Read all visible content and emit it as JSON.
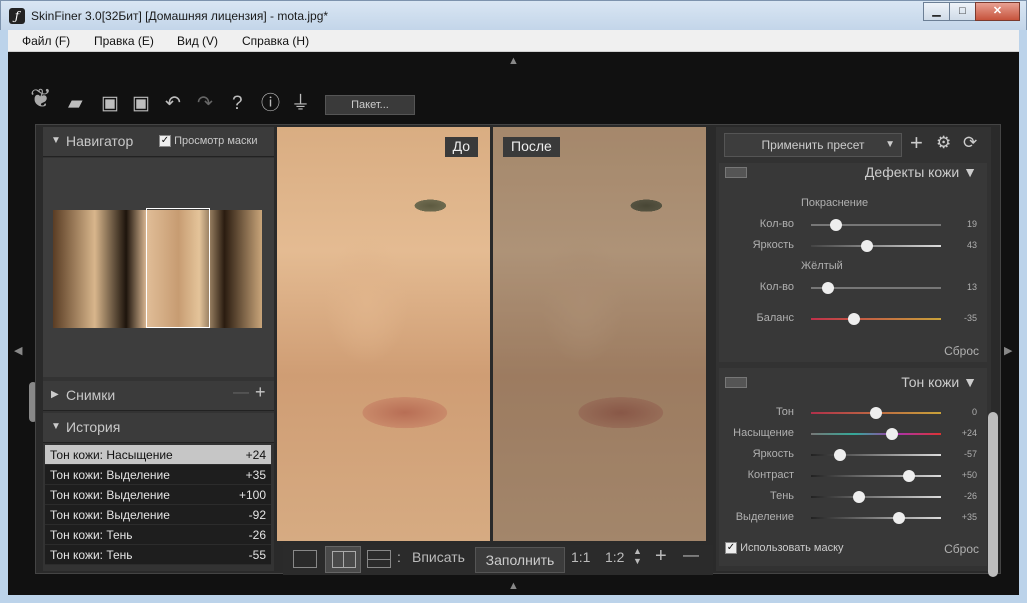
{
  "window": {
    "title": "SkinFiner 3.0[32Бит] [Домашняя лицензия] - mota.jpg*",
    "min": "▁",
    "max": "□",
    "close": "✕"
  },
  "menu": [
    {
      "label": "Файл (F)"
    },
    {
      "label": "Правка (E)"
    },
    {
      "label": "Вид (V)"
    },
    {
      "label": "Справка (H)"
    }
  ],
  "toolbar": {
    "batch_label": "Пакет..."
  },
  "navigator": {
    "title": "Навигатор",
    "mask_preview_label": "Просмотр маски"
  },
  "snapshots": {
    "title": "Снимки",
    "minus": "—",
    "plus": "+"
  },
  "history": {
    "title": "История",
    "items": [
      {
        "name": "Тон кожи: Насыщение",
        "value": "+24"
      },
      {
        "name": "Тон кожи: Выделение",
        "value": "+35"
      },
      {
        "name": "Тон кожи: Выделение",
        "value": "+100"
      },
      {
        "name": "Тон кожи: Выделение",
        "value": "-92"
      },
      {
        "name": "Тон кожи: Тень",
        "value": "-26"
      },
      {
        "name": "Тон кожи: Тень",
        "value": "-55"
      }
    ]
  },
  "preview": {
    "before_label": "До",
    "after_label": "После"
  },
  "view_bar": {
    "separator": ":",
    "fit_label": "Вписать",
    "fill_label": "Заполнить",
    "zoom_1_1": "1:1",
    "zoom_1_2": "1:2",
    "zoom_in": "+",
    "zoom_out": "—"
  },
  "preset": {
    "label": "Применить пресет",
    "arrow": "▼"
  },
  "skin_defects": {
    "title": "Дефекты кожи",
    "group_redness": "Покраснение",
    "group_yellow": "Жёлтый",
    "amount1": {
      "label": "Кол-во",
      "value": "19",
      "level": 0.19
    },
    "brightness": {
      "label": "Яркость",
      "value": "43",
      "level": 0.43
    },
    "amount2": {
      "label": "Кол-во",
      "value": "13",
      "level": 0.13
    },
    "balance": {
      "label": "Баланс",
      "value": "-35",
      "level": 0.33
    },
    "reset": "Сброс"
  },
  "skin_tone": {
    "title": "Тон кожи",
    "sliders": [
      {
        "label": "Тон",
        "value": "0",
        "level": 0.5
      },
      {
        "label": "Насыщение",
        "value": "+24",
        "level": 0.62
      },
      {
        "label": "Яркость",
        "value": "-57",
        "level": 0.22
      },
      {
        "label": "Контраст",
        "value": "+50",
        "level": 0.75
      },
      {
        "label": "Тень",
        "value": "-26",
        "level": 0.37
      },
      {
        "label": "Выделение",
        "value": "+35",
        "level": 0.68
      }
    ],
    "use_mask_label": "Использовать маску",
    "reset": "Сброс"
  }
}
